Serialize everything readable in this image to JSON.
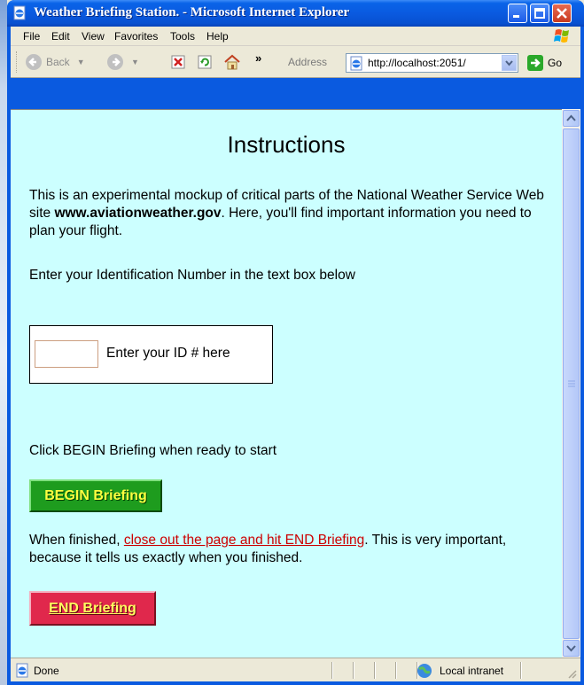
{
  "window": {
    "title": "Weather Briefing Station. - Microsoft Internet Explorer"
  },
  "menu": {
    "items": [
      {
        "label": "File"
      },
      {
        "label": "Edit"
      },
      {
        "label": "View"
      },
      {
        "label": "Favorites"
      },
      {
        "label": "Tools"
      },
      {
        "label": "Help"
      }
    ]
  },
  "toolbar": {
    "back_label": "Back",
    "more_label": "»",
    "address_label": "Address",
    "address_value": "http://localhost:2051/",
    "go_label": "Go"
  },
  "content": {
    "heading": "Instructions",
    "intro_before": "This is an experimental mockup of critical parts of the National Weather Service Web site ",
    "intro_site": "www.aviationweather.gov",
    "intro_after": ".  Here, you'll find important information you need to plan your flight.",
    "enter_id_instruction": "Enter your Identification Number in the text box below",
    "id_input_value": "",
    "id_label": "Enter your ID # here",
    "begin_instruction": "Click BEGIN Briefing when ready to start",
    "begin_button_label": "BEGIN Briefing",
    "finish_before": "When finished, ",
    "finish_link": "close out the page and hit END Briefing",
    "finish_after": ".  This is very important, because it tells us exactly when you finished.",
    "end_button_label": "END Briefing"
  },
  "status": {
    "text": "Done",
    "zone": "Local intranet"
  },
  "colors": {
    "page_background": "#ccffff",
    "begin_button": "#1e9c1e",
    "end_button": "#e0284c",
    "link": "#cc0000",
    "titlebar": "#0a5ae0"
  }
}
